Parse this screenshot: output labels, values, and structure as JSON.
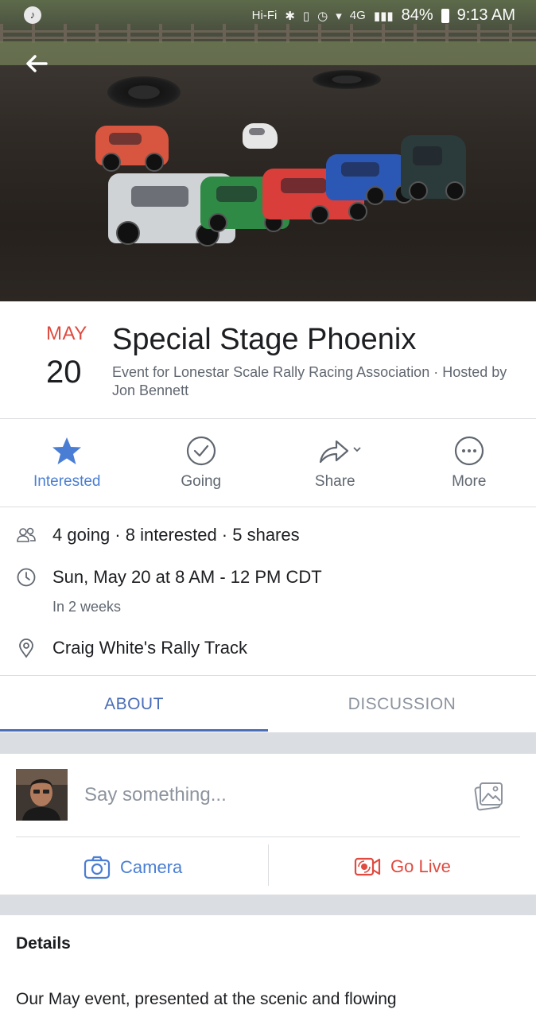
{
  "status_bar": {
    "network": "4G",
    "hifi": "Hi-Fi",
    "battery": "84%",
    "time": "9:13 AM"
  },
  "event": {
    "month": "MAY",
    "day": "20",
    "title": "Special Stage Phoenix",
    "subtitle": "Event for Lonestar Scale Rally Racing Association · Hosted by Jon Bennett"
  },
  "actions": [
    {
      "label": "Interested",
      "icon": "star-icon",
      "active": true
    },
    {
      "label": "Going",
      "icon": "check-circle-icon",
      "active": false
    },
    {
      "label": "Share",
      "icon": "share-arrow-icon",
      "active": false
    },
    {
      "label": "More",
      "icon": "more-dots-icon",
      "active": false
    }
  ],
  "info": {
    "attendance": "4 going · 8 interested · 5 shares",
    "datetime": "Sun, May 20 at 8 AM - 12 PM CDT",
    "relative_time": "In 2 weeks",
    "location": "Craig White's Rally Track"
  },
  "tabs": [
    {
      "label": "ABOUT",
      "active": true
    },
    {
      "label": "DISCUSSION",
      "active": false
    }
  ],
  "composer": {
    "placeholder": "Say something...",
    "camera_label": "Camera",
    "golive_label": "Go Live"
  },
  "details": {
    "heading": "Details",
    "text": "Our May event, presented at the scenic and flowing"
  },
  "colors": {
    "accent_blue": "#4a7ed4",
    "month_red": "#e04a3f",
    "live_red": "#e04a3f",
    "tab_active": "#4a6db8"
  }
}
